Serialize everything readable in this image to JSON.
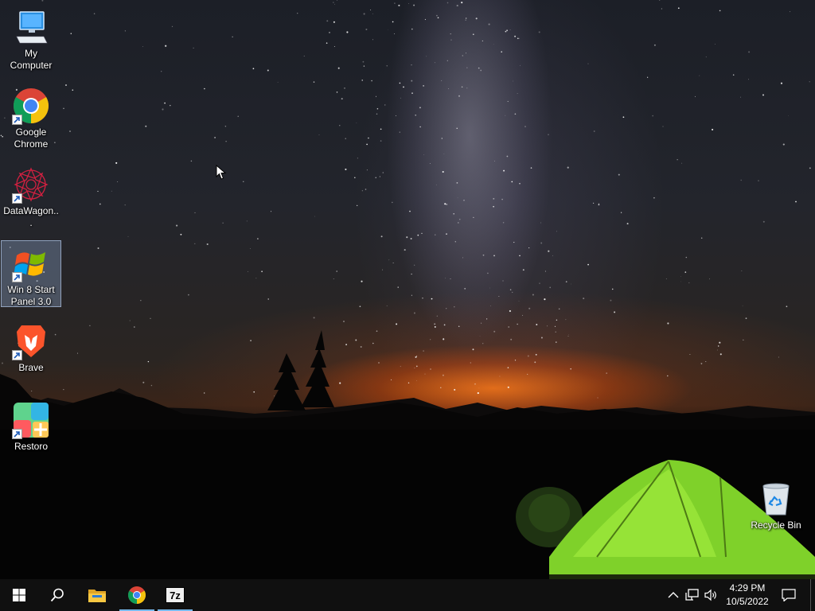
{
  "desktop": {
    "icons": [
      {
        "label": "My Computer"
      },
      {
        "label": "Google Chrome"
      },
      {
        "label": "DataWagon..."
      },
      {
        "label": "Win 8 Start Panel 3.0"
      },
      {
        "label": "Brave"
      },
      {
        "label": "Restoro"
      },
      {
        "label": "Recycle Bin"
      }
    ]
  },
  "taskbar": {
    "start": {
      "icon": "windows-logo-icon"
    },
    "search": {
      "icon": "search-icon"
    },
    "pinned": [
      {
        "icon": "file-explorer-icon",
        "active": false
      },
      {
        "icon": "chrome-icon",
        "active": true
      },
      {
        "icon": "7zip-icon",
        "label": "7z",
        "active": true
      }
    ],
    "tray": {
      "icons": [
        "chevron-up-icon",
        "network-icon",
        "volume-icon"
      ],
      "time": "4:29 PM",
      "date": "10/5/2022",
      "notification_icon": "action-center-icon"
    }
  },
  "colors": {
    "taskbar_bg": "#101010",
    "active_indicator": "#76b9ed",
    "tent_green": "#8ee02a"
  }
}
